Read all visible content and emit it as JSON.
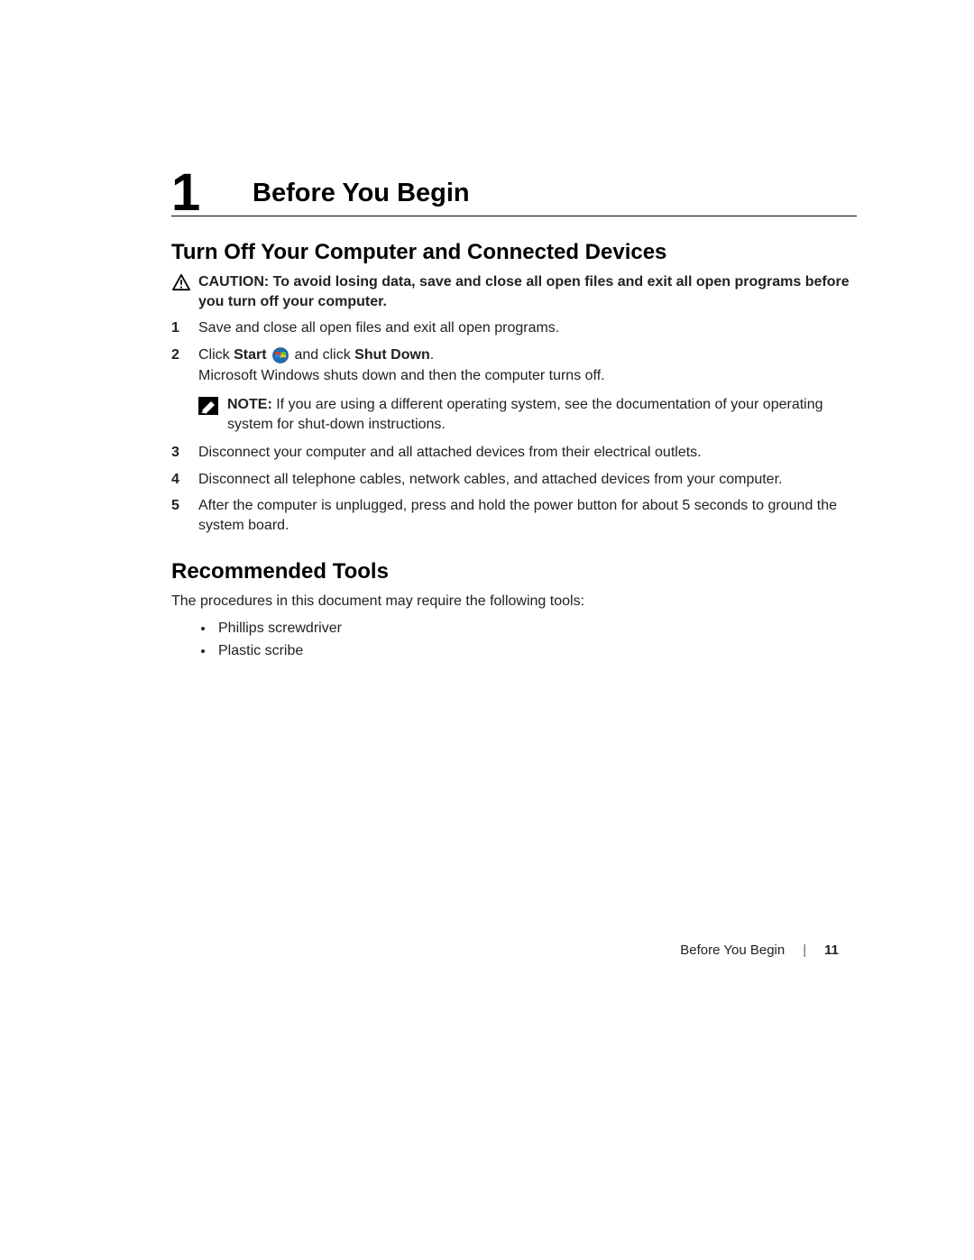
{
  "chapter": {
    "number": "1",
    "title": "Before You Begin"
  },
  "section1": {
    "heading": "Turn Off Your Computer and Connected Devices",
    "caution": "CAUTION: To avoid losing data, save and close all open files and exit all open programs before you turn off your computer.",
    "steps": {
      "s1": {
        "num": "1",
        "text": "Save and close all open files and exit all open programs."
      },
      "s2": {
        "num": "2",
        "pre": "Click ",
        "start": "Start",
        "mid": " and click ",
        "shut": "Shut Down",
        "post": ".",
        "line2": "Microsoft Windows shuts down and then the computer turns off."
      },
      "note": {
        "label": "NOTE:",
        "text": " If you are using a different operating system, see the documentation of your operating system for shut-down instructions."
      },
      "s3": {
        "num": "3",
        "text": "Disconnect your computer and all attached devices from their electrical outlets."
      },
      "s4": {
        "num": "4",
        "text": "Disconnect all telephone cables, network cables, and attached devices from your computer."
      },
      "s5": {
        "num": "5",
        "text": "After the computer is unplugged, press and hold the power button for about 5 seconds to ground the system board."
      }
    }
  },
  "section2": {
    "heading": "Recommended Tools",
    "intro": "The procedures in this document may require the following tools:",
    "bullets": {
      "b1": "Phillips screwdriver",
      "b2": "Plastic scribe"
    }
  },
  "footer": {
    "title": "Before You Begin",
    "sep": "|",
    "page": "11"
  }
}
